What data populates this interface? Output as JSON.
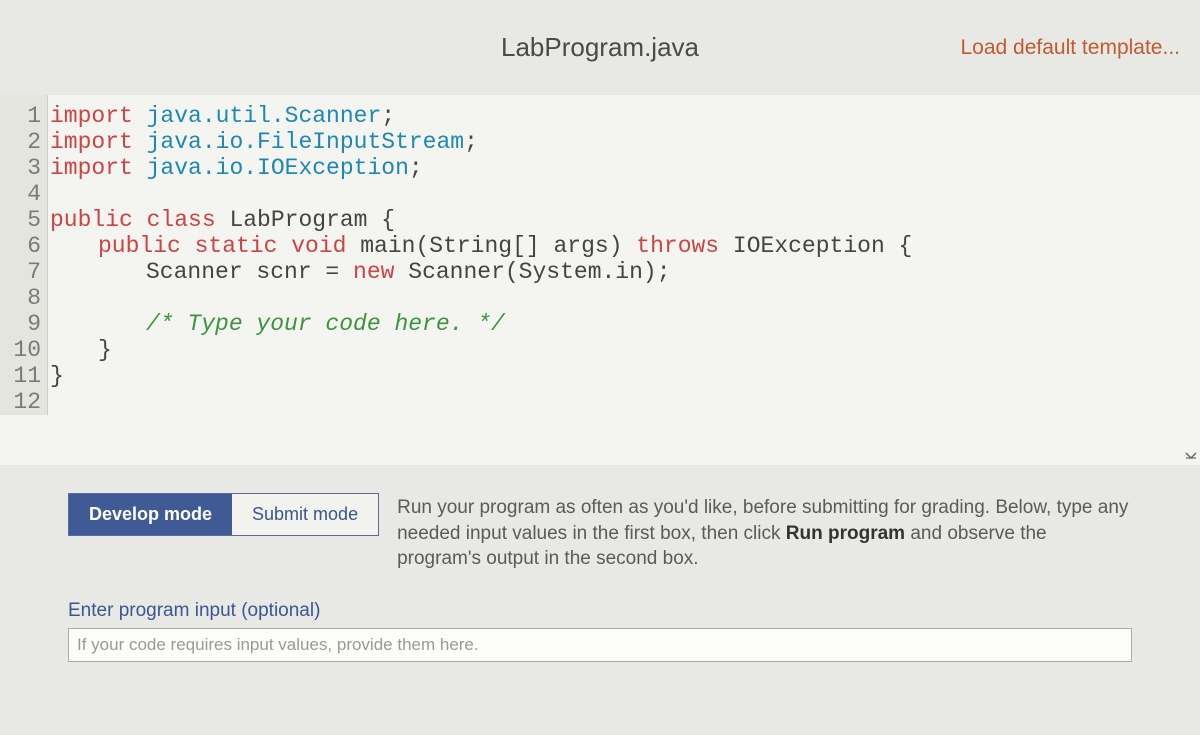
{
  "header": {
    "file_title": "LabProgram.java",
    "load_template": "Load default template..."
  },
  "editor": {
    "gutter": [
      "1",
      "2",
      "3",
      "4",
      "5",
      "6",
      "7",
      "8",
      "9",
      "10",
      "11",
      "12"
    ],
    "code": {
      "l1": {
        "kw": "import ",
        "pkg": "java.util.Scanner",
        "semi": ";"
      },
      "l2": {
        "kw": "import ",
        "pkg": "java.io.FileInputStream",
        "semi": ";"
      },
      "l3": {
        "kw": "import ",
        "pkg": "java.io.IOException",
        "semi": ";"
      },
      "l4": "",
      "l5": {
        "a": "public class ",
        "b": "LabProgram {"
      },
      "l6": {
        "a": "public static void ",
        "b": "main(String[] args) ",
        "c": "throws ",
        "d": "IOException {"
      },
      "l7": {
        "a": "Scanner scnr = ",
        "b": "new ",
        "c": "Scanner(System.in);"
      },
      "l8": "",
      "l9": {
        "a": "/* Type your code here. */"
      },
      "l10": {
        "a": "}"
      },
      "l11": {
        "a": "}"
      },
      "l12": ""
    }
  },
  "modes": {
    "develop": "Develop mode",
    "submit": "Submit mode",
    "hint_a": "Run your program as often as you'd like, before submitting for grading. Below, type any needed input values in the first box, then click ",
    "hint_bold": "Run program",
    "hint_b": " and observe the program's output in the second box."
  },
  "input": {
    "label": "Enter program input (optional)",
    "placeholder": "If your code requires input values, provide them here."
  }
}
